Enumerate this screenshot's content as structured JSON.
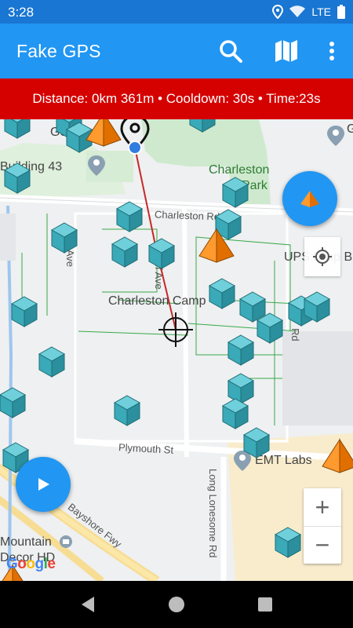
{
  "status_bar": {
    "time": "3:28",
    "network": "LTE"
  },
  "app_bar": {
    "title": "Fake GPS",
    "actions": [
      {
        "name": "search",
        "icon": "search-icon"
      },
      {
        "name": "map",
        "icon": "map-icon"
      },
      {
        "name": "overflow",
        "icon": "more-vert-icon"
      }
    ]
  },
  "info_banner": {
    "text": "Distance: 0km 361m • Cooldown: 30s • Time:23s"
  },
  "map": {
    "places": {
      "building": "Building 43",
      "google": "Goo",
      "g": "G",
      "park": "Charleston",
      "park_line2": "Park",
      "campus": "Charleston Camp",
      "ups": "UPS Drop B",
      "emt": "EMT Labs",
      "mountain": "Mountain",
      "mountain_line2": "Decor HD"
    },
    "streets": {
      "charleston_rd": "Charleston Rd",
      "huff_ave": "Huff Ave",
      "plymouth": "Plymouth St",
      "long_lonesome": "Long Lonesome Rd",
      "bayshore": "Bayshore Fwy",
      "ave_left": "Ave",
      "rd_right": "Rd"
    },
    "attribution": [
      "G",
      "o",
      "o",
      "g",
      "l",
      "e"
    ]
  },
  "colors": {
    "primary": "#2196f3",
    "primary_dark": "#1976d2",
    "banner": "#d50000",
    "cube": "#3fb5c4",
    "pyramid": "#f57c00",
    "route": "#c62828"
  },
  "buttons": {
    "zoom_in": "+",
    "zoom_out": "−"
  }
}
